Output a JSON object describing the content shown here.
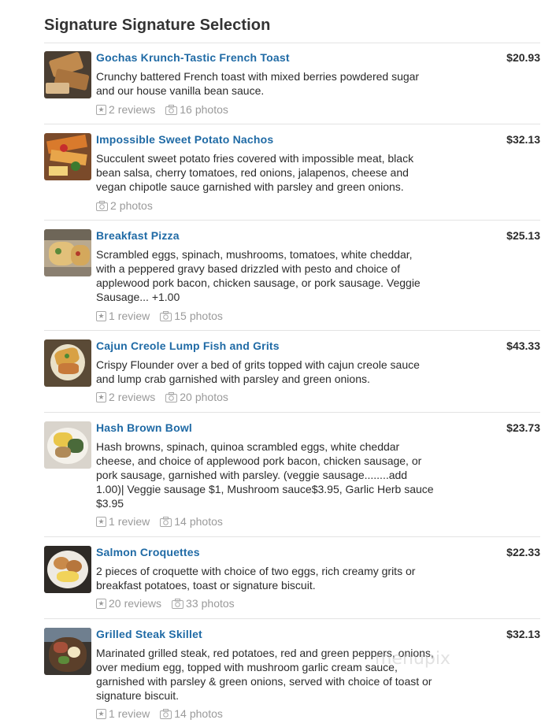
{
  "section": {
    "title": "Signature Signature Selection"
  },
  "labels": {
    "reviews": "reviews",
    "review": "review",
    "photos": "photos"
  },
  "items": [
    {
      "name": "Gochas Krunch-Tastic French Toast",
      "price": "$20.93",
      "description": "Crunchy battered French toast with mixed berries powdered sugar and our house vanilla bean sauce.",
      "reviews": "2",
      "photos": "16"
    },
    {
      "name": "Impossible Sweet Potato Nachos",
      "price": "$32.13",
      "description": "Succulent sweet potato fries covered with impossible meat, black bean salsa, cherry tomatoes, red onions, jalapenos, cheese and vegan chipotle sauce garnished with parsley and green onions.",
      "photos": "2"
    },
    {
      "name": "Breakfast Pizza",
      "price": "$25.13",
      "description": "Scrambled eggs, spinach, mushrooms, tomatoes, white cheddar, with a peppered gravy based drizzled with pesto and choice of applewood pork bacon, chicken sausage, or pork sausage. Veggie Sausage... +1.00",
      "reviews": "1",
      "photos": "15"
    },
    {
      "name": "Cajun Creole Lump Fish and Grits",
      "price": "$43.33",
      "description": "Crispy Flounder over a bed of grits topped with cajun creole sauce and lump crab garnished with parsley and green onions.",
      "reviews": "2",
      "photos": "20"
    },
    {
      "name": "Hash Brown Bowl",
      "price": "$23.73",
      "description": "Hash browns, spinach, quinoa scrambled eggs, white cheddar cheese, and choice of applewood pork bacon, chicken sausage, or pork sausage, garnished with parsley. (veggie sausage........add 1.00)| Veggie sausage $1, Mushroom sauce$3.95, Garlic Herb sauce $3.95",
      "reviews": "1",
      "photos": "14"
    },
    {
      "name": "Salmon Croquettes",
      "price": "$22.33",
      "description": "2 pieces of croquette with choice of two eggs, rich creamy grits or breakfast potatoes, toast or signature biscuit.",
      "reviews": "20",
      "photos": "33"
    },
    {
      "name": "Grilled Steak Skillet",
      "price": "$32.13",
      "description": "Marinated grilled steak, red potatoes, red and green peppers, onions, over medium egg, topped with mushroom garlic cream sauce, garnished with parsley & green onions, served with choice of toast or signature biscuit.",
      "reviews": "1",
      "photos": "14"
    }
  ],
  "watermark": "menupix",
  "icons": {
    "review": "star-review-icon",
    "photo": "camera-icon"
  },
  "colors": {
    "link": "#1f6aa5",
    "meta": "#9a9a9a",
    "rule": "#e3e3e3"
  }
}
